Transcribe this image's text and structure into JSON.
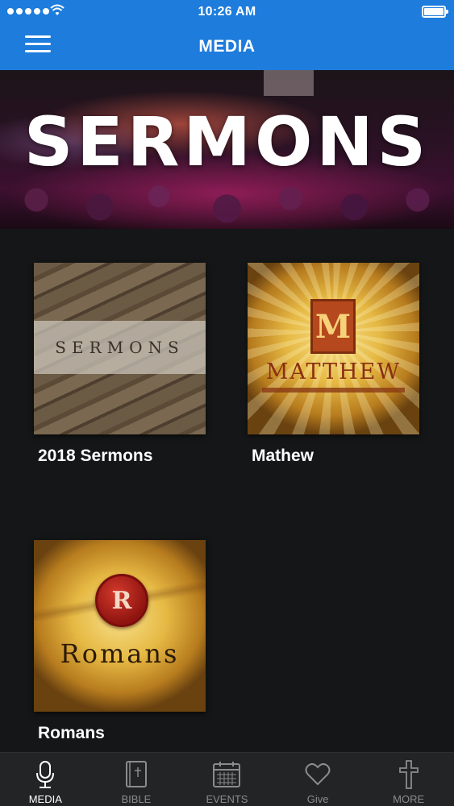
{
  "status_bar": {
    "time": "10:26 AM"
  },
  "header": {
    "title": "MEDIA"
  },
  "banner": {
    "title": "SERMONS"
  },
  "media_items": [
    {
      "label": "2018 Sermons",
      "art_text": "SERMONS"
    },
    {
      "label": "Mathew",
      "art_text": "MATTHEW",
      "art_initial": "M"
    },
    {
      "label": "Romans",
      "art_text": "Romans",
      "art_initial": "R"
    }
  ],
  "tabs": [
    {
      "label": "MEDIA",
      "icon": "microphone-icon",
      "active": true
    },
    {
      "label": "BIBLE",
      "icon": "bible-icon",
      "active": false
    },
    {
      "label": "EVENTS",
      "icon": "calendar-icon",
      "active": false
    },
    {
      "label": "Give",
      "icon": "heart-icon",
      "active": false
    },
    {
      "label": "MORE",
      "icon": "cross-icon",
      "active": false
    }
  ],
  "colors": {
    "header": "#1d7cdc",
    "background": "#141617",
    "tabbar": "#222425"
  }
}
